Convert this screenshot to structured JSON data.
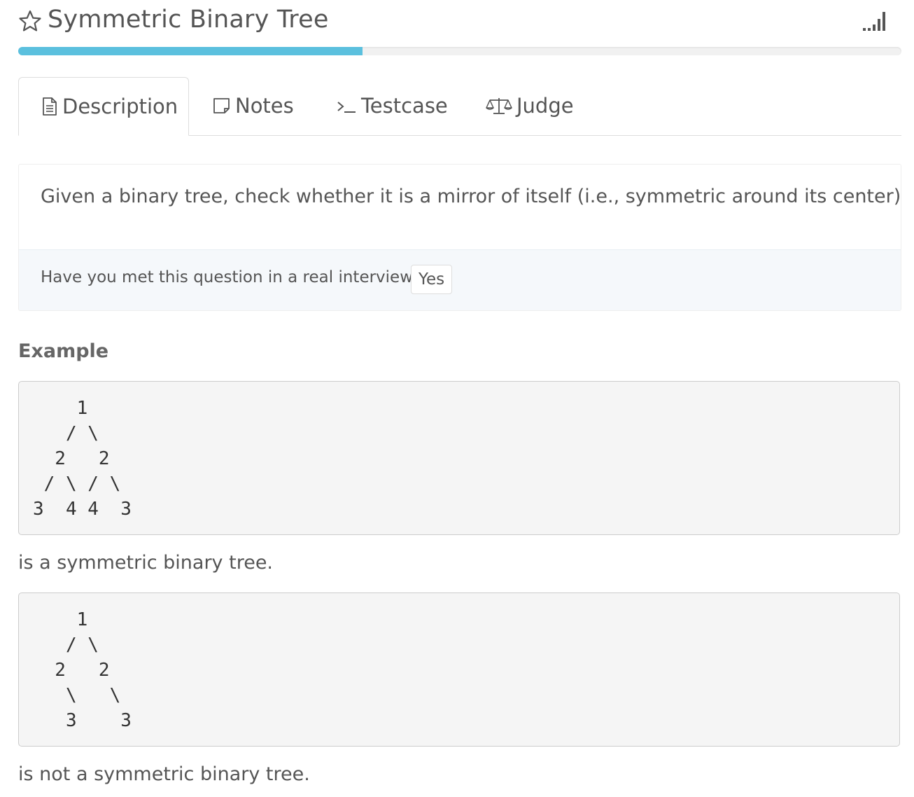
{
  "problem": {
    "title": "Symmetric Binary Tree",
    "progress_percent": 39
  },
  "tabs": [
    {
      "label": "Description",
      "icon": "document-icon",
      "active": true
    },
    {
      "label": "Notes",
      "icon": "note-icon",
      "active": false
    },
    {
      "label": "Testcase",
      "icon": "terminal-icon",
      "active": false
    },
    {
      "label": "Judge",
      "icon": "balance-scale-icon",
      "active": false
    }
  ],
  "description": {
    "text": "Given a binary tree, check whether it is a mirror of itself (i.e., symmetric around its center).",
    "interview_question": "Have you met this question in a real interview?",
    "yes_label": "Yes"
  },
  "example": {
    "heading": "Example",
    "tree_1": "    1\n   / \\\n  2   2\n / \\ / \\\n3  4 4  3",
    "caption_1": "is a symmetric binary tree.",
    "tree_2": "    1\n   / \\\n  2   2\n   \\   \\\n   3    3",
    "caption_2": "is not a symmetric binary tree."
  },
  "colors": {
    "progress": "#5bc0de",
    "text": "#555555",
    "code_background": "#f5f5f5"
  }
}
